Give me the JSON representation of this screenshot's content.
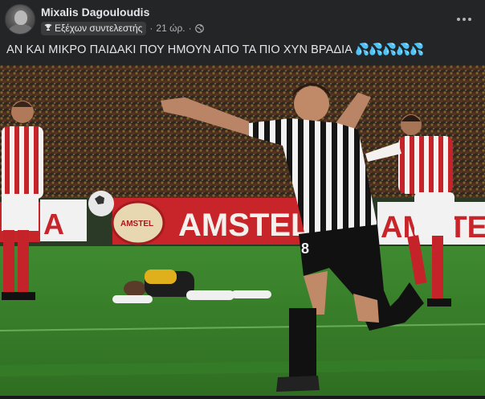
{
  "post": {
    "author": "Mixalis Dagouloudis",
    "badge_label": "Εξέχων συντελεστής",
    "timestamp": "21 ώρ.",
    "separator": "·",
    "text": "ΑΝ ΚΑΙ ΜΙΚΡΟ ΠΑΙΔΑΚΙ ΠΟΥ ΗΜΟΥΝ ΑΠΟ ΤΑ ΠΙΟ ΧΥΝ ΒΡΑΔΙΑ",
    "emoji": "💦💦💦💦💦"
  },
  "photo": {
    "ad_boards": [
      "A",
      "AMSTEL",
      "AMSTEL",
      "AMSTEL"
    ],
    "player_number": "8",
    "icon_semantics": [
      "avatar",
      "trophy-icon",
      "globe-icon",
      "more-options-icon"
    ]
  },
  "colors": {
    "background": "#242526",
    "text_primary": "#e4e6eb",
    "text_secondary": "#b0b3b8",
    "badge_bg": "#3a3b3c",
    "pitch_green": "#3f7d2c",
    "ad_red": "#c8252b"
  }
}
